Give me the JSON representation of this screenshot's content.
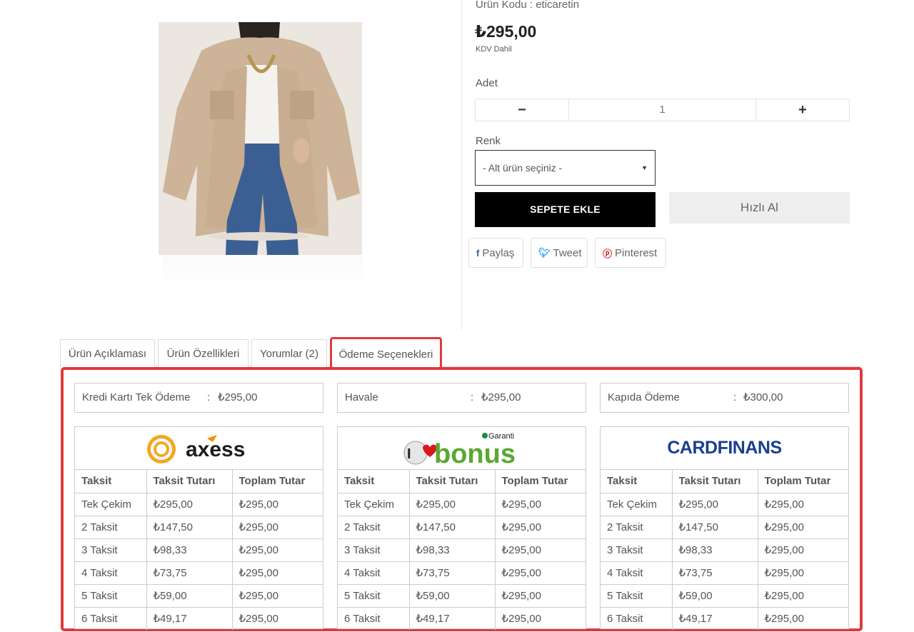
{
  "product": {
    "code_text": "Ürün Kodu : eticaretin",
    "price": "₺295,00",
    "vat": "KDV Dahil",
    "quantity_label": "Adet",
    "quantity_value": "1",
    "minus": "−",
    "plus": "+",
    "color_label": "Renk",
    "color_select": "- Alt ürün seçiniz -",
    "add_to_cart": "SEPETE EKLE",
    "quick_buy": "Hızlı Al"
  },
  "share": {
    "facebook": "Paylaş",
    "twitter": "Tweet",
    "pinterest": "Pinterest"
  },
  "tabs": [
    "Ürün Açıklaması",
    "Ürün Özellikleri",
    "Yorumlar (2)",
    "Ödeme Seçenekleri"
  ],
  "summary": [
    {
      "label": "Kredi Kartı Tek Ödeme",
      "sep": ":",
      "value": "₺295,00"
    },
    {
      "label": "Havale",
      "sep": ":",
      "value": "₺295,00"
    },
    {
      "label": "Kapıda Ödeme",
      "sep": ":",
      "value": "₺300,00"
    }
  ],
  "installment_headers": [
    "Taksit",
    "Taksit Tutarı",
    "Toplam Tutar"
  ],
  "cards": [
    {
      "logo": "axess",
      "rows": [
        [
          "Tek Çekim",
          "₺295,00",
          "₺295,00"
        ],
        [
          "2 Taksit",
          "₺147,50",
          "₺295,00"
        ],
        [
          "3 Taksit",
          "₺98,33",
          "₺295,00"
        ],
        [
          "4 Taksit",
          "₺73,75",
          "₺295,00"
        ],
        [
          "5 Taksit",
          "₺59,00",
          "₺295,00"
        ],
        [
          "6 Taksit",
          "₺49,17",
          "₺295,00"
        ]
      ]
    },
    {
      "logo": "bonus",
      "logo_small": "Garanti",
      "rows": [
        [
          "Tek Çekim",
          "₺295,00",
          "₺295,00"
        ],
        [
          "2 Taksit",
          "₺147,50",
          "₺295,00"
        ],
        [
          "3 Taksit",
          "₺98,33",
          "₺295,00"
        ],
        [
          "4 Taksit",
          "₺73,75",
          "₺295,00"
        ],
        [
          "5 Taksit",
          "₺59,00",
          "₺295,00"
        ],
        [
          "6 Taksit",
          "₺49,17",
          "₺295,00"
        ]
      ]
    },
    {
      "logo": "CARDFINANS",
      "rows": [
        [
          "Tek Çekim",
          "₺295,00",
          "₺295,00"
        ],
        [
          "2 Taksit",
          "₺147,50",
          "₺295,00"
        ],
        [
          "3 Taksit",
          "₺98,33",
          "₺295,00"
        ],
        [
          "4 Taksit",
          "₺73,75",
          "₺295,00"
        ],
        [
          "5 Taksit",
          "₺59,00",
          "₺295,00"
        ],
        [
          "6 Taksit",
          "₺49,17",
          "₺295,00"
        ]
      ]
    }
  ],
  "colors": {
    "accent": "#e0393e",
    "cart_button": "#000000",
    "quick_button": "#eeeeee",
    "facebook": "#3b5998",
    "twitter": "#1da1f2",
    "pinterest": "#cb2027"
  }
}
